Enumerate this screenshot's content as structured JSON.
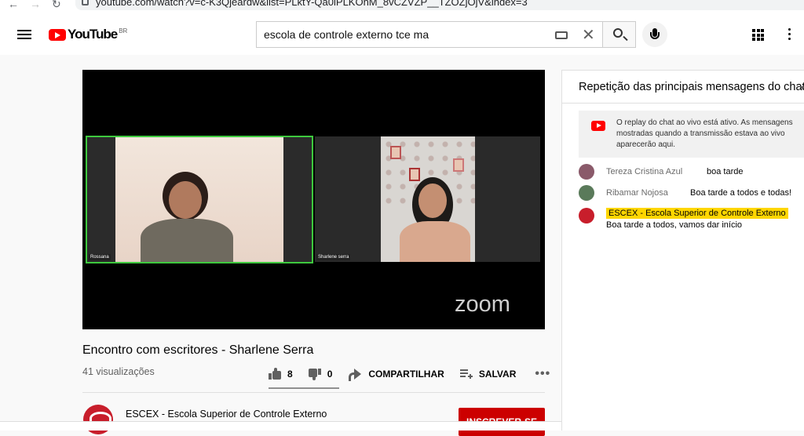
{
  "browser": {
    "url": "youtube.com/watch?v=c-K3Qjeardw&list=PLktY-Qa0iPLKOnM_8vCZVZP__TZOZjOjV&index=3"
  },
  "masthead": {
    "logo_text": "YouTube",
    "country": "BR",
    "search_query": "escola de controle externo tce ma"
  },
  "player": {
    "participants": [
      {
        "name": "Rossana"
      },
      {
        "name": "Sharlene serra"
      }
    ],
    "watermark": "zoom"
  },
  "video": {
    "title": "Encontro com escritores - Sharlene Serra",
    "views": "41 visualizações",
    "likes": "8",
    "dislikes": "0",
    "share_label": "COMPARTILHAR",
    "save_label": "SALVAR",
    "more_label": "•••"
  },
  "channel": {
    "name": "ESCEX - Escola Superior de Controle Externo",
    "subscribe_label": "INSCREVER-SE"
  },
  "chat": {
    "header": "Repetição das principais mensagens do chat",
    "replay_notice": "O replay do chat ao vivo está ativo. As mensagens mostradas quando a transmissão estava ao vivo aparecerão aqui.",
    "messages": [
      {
        "author": "Tereza Cristina Azul",
        "text": "boa tarde",
        "avatar_color": "#8a5a6a"
      },
      {
        "author": "Ribamar Nojosa",
        "text": "Boa tarde a todos e todas!",
        "avatar_color": "#5a7a5a"
      },
      {
        "author": "ESCEX - Escola Superior de Controle Externo",
        "text": "Boa tarde a todos, vamos dar início",
        "avatar_color": "#c81e2b"
      }
    ]
  },
  "colors": {
    "brand_red": "#ff0000",
    "subscribe_red": "#cc0000",
    "speaker_border": "#3ec93e",
    "owner_highlight": "#ffd600"
  }
}
